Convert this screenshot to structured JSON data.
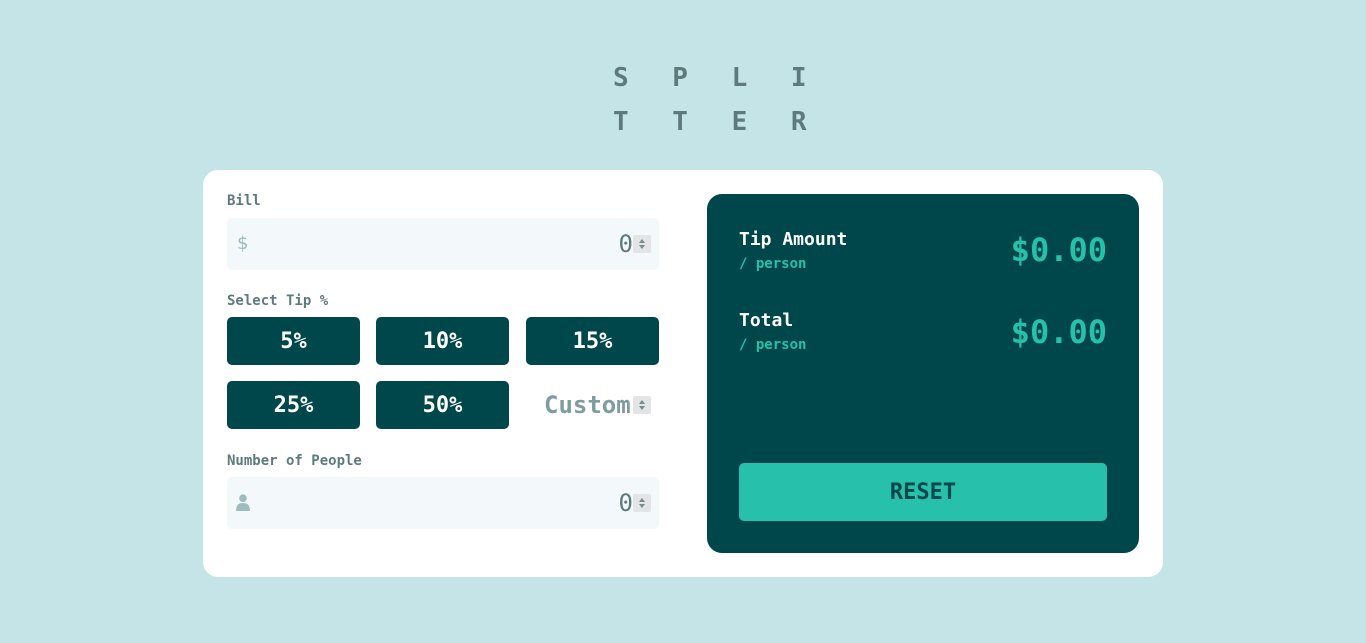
{
  "logo": {
    "line1": "S P L I",
    "line2": "T T E R"
  },
  "bill": {
    "label": "Bill",
    "currency_symbol": "$",
    "value": "0"
  },
  "tip": {
    "label": "Select Tip %",
    "options": [
      "5%",
      "10%",
      "15%",
      "25%",
      "50%"
    ],
    "custom_placeholder": "Custom"
  },
  "people": {
    "label": "Number of People",
    "value": "0"
  },
  "results": {
    "tip_amount_label": "Tip Amount",
    "tip_amount_sub": "/ person",
    "tip_amount_value": "$0.00",
    "total_label": "Total",
    "total_sub": "/ person",
    "total_value": "$0.00",
    "reset_label": "RESET"
  },
  "colors": {
    "background": "#c5e4e7",
    "dark_cyan": "#00474b",
    "strong_cyan": "#26c0ab",
    "grayish_cyan": "#5e7a7d",
    "input_bg": "#f3f9fa"
  },
  "icons": {
    "bill_prefix": "dollar-icon",
    "people_prefix": "person-icon"
  }
}
